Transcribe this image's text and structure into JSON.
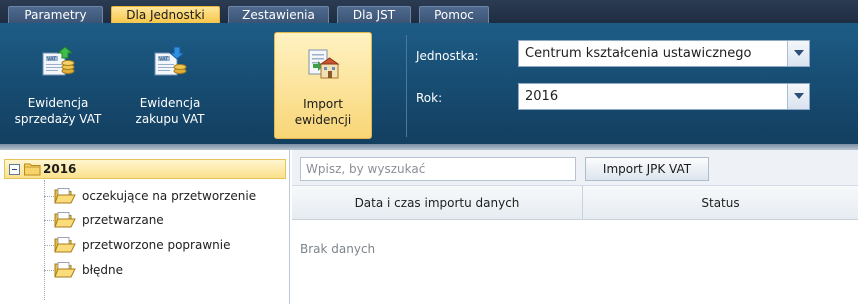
{
  "tabs": [
    {
      "label": "Parametry",
      "active": false
    },
    {
      "label": "Dla Jednostki",
      "active": true
    },
    {
      "label": "Zestawienia",
      "active": false
    },
    {
      "label": "Dla JST",
      "active": false
    },
    {
      "label": "Pomoc",
      "active": false
    }
  ],
  "ribbon": {
    "buttons": [
      {
        "label": "Ewidencja\nsprzedaży VAT",
        "icon": "vat-sales-register-icon"
      },
      {
        "label": "Ewidencja\nzakupu VAT",
        "icon": "vat-purchase-register-icon"
      },
      {
        "label": "Import\newidencji",
        "icon": "import-register-icon",
        "active": true
      }
    ],
    "unit_label": "Jednostka:",
    "unit_value": "Centrum kształcenia ustawicznego",
    "year_label": "Rok:",
    "year_value": "2016"
  },
  "tree": {
    "root": "2016",
    "items": [
      "oczekujące na przetworzenie",
      "przetwarzane",
      "przetworzone poprawnie",
      "błędne"
    ]
  },
  "grid": {
    "search_placeholder": "Wpisz, by wyszukać",
    "import_button": "Import JPK VAT",
    "columns": [
      "Data i czas importu danych",
      "Status"
    ],
    "empty_message": "Brak danych"
  },
  "colors": {
    "ribbon_bg": "#184e74",
    "active_tab": "#f6c64b",
    "active_button": "#f8d677",
    "selected_tree_item": "#fbe08b"
  }
}
